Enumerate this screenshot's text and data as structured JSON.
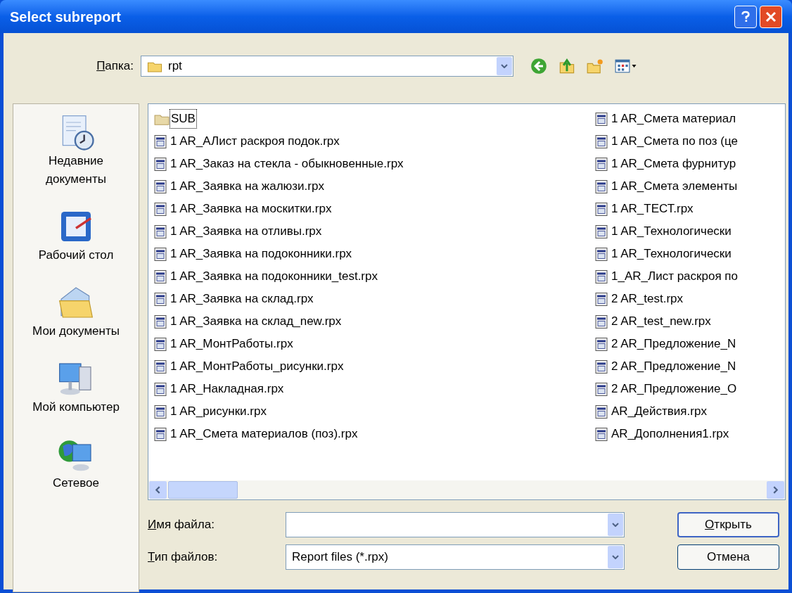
{
  "window": {
    "title": "Select subreport"
  },
  "look_in": {
    "label": {
      "accel": "П",
      "rest": "апка:"
    },
    "value": "rpt"
  },
  "places": [
    {
      "kind": "recent",
      "label": "Недавние документы"
    },
    {
      "kind": "desktop",
      "label": "Рабочий стол"
    },
    {
      "kind": "documents",
      "label": "Мои документы"
    },
    {
      "kind": "computer",
      "label": "Мой компьютер"
    },
    {
      "kind": "network",
      "label": "Сетевое"
    }
  ],
  "files": [
    [
      {
        "kind": "folder",
        "name": "SUB",
        "focused": true
      },
      {
        "kind": "file",
        "name": "1  AR_АЛист раскроя подок.rpx",
        "focused": false
      },
      {
        "kind": "file",
        "name": "1 AR_Заказ на стекла - обыкновенные.rpx",
        "focused": false
      },
      {
        "kind": "file",
        "name": "1 AR_Заявка на жалюзи.rpx",
        "focused": false
      },
      {
        "kind": "file",
        "name": "1 AR_Заявка на москитки.rpx",
        "focused": false
      },
      {
        "kind": "file",
        "name": "1 AR_Заявка на отливы.rpx",
        "focused": false
      },
      {
        "kind": "file",
        "name": "1 AR_Заявка на подоконники.rpx",
        "focused": false
      },
      {
        "kind": "file",
        "name": "1 AR_Заявка на подоконники_test.rpx",
        "focused": false
      },
      {
        "kind": "file",
        "name": "1 AR_Заявка на склад.rpx",
        "focused": false
      },
      {
        "kind": "file",
        "name": "1 AR_Заявка на склад_new.rpx",
        "focused": false
      },
      {
        "kind": "file",
        "name": "1 AR_МонтРаботы.rpx",
        "focused": false
      },
      {
        "kind": "file",
        "name": "1 AR_МонтРаботы_рисунки.rpx",
        "focused": false
      },
      {
        "kind": "file",
        "name": "1 AR_Накладная.rpx",
        "focused": false
      },
      {
        "kind": "file",
        "name": "1 AR_рисунки.rpx",
        "focused": false
      },
      {
        "kind": "file",
        "name": "1 AR_Смета материалов (поз).rpx",
        "focused": false
      }
    ],
    [
      {
        "kind": "file",
        "name": "1 AR_Смета материал",
        "focused": false
      },
      {
        "kind": "file",
        "name": "1 AR_Смета по поз (це",
        "focused": false
      },
      {
        "kind": "file",
        "name": "1 AR_Смета фурнитур",
        "focused": false
      },
      {
        "kind": "file",
        "name": "1 AR_Смета элементы",
        "focused": false
      },
      {
        "kind": "file",
        "name": "1 AR_ТЕСТ.rpx",
        "focused": false
      },
      {
        "kind": "file",
        "name": "1 AR_Технологически",
        "focused": false
      },
      {
        "kind": "file",
        "name": "1 AR_Технологически",
        "focused": false
      },
      {
        "kind": "file",
        "name": "1_AR_Лист раскроя по",
        "focused": false
      },
      {
        "kind": "file",
        "name": "2 AR_test.rpx",
        "focused": false
      },
      {
        "kind": "file",
        "name": "2 AR_test_new.rpx",
        "focused": false
      },
      {
        "kind": "file",
        "name": "2 AR_Предложение_N",
        "focused": false
      },
      {
        "kind": "file",
        "name": "2 AR_Предложение_N",
        "focused": false
      },
      {
        "kind": "file",
        "name": "2 AR_Предложение_О",
        "focused": false
      },
      {
        "kind": "file",
        "name": "AR_Действия.rpx",
        "focused": false
      },
      {
        "kind": "file",
        "name": "AR_Дополнения1.rpx",
        "focused": false
      }
    ]
  ],
  "file_name": {
    "label": {
      "accel": "И",
      "rest": "мя файла:"
    }
  },
  "file_type": {
    "label": {
      "accel": "Т",
      "rest": "ип файлов:"
    },
    "value": "Report files (*.rpx)"
  },
  "buttons": [
    {
      "kind": "default",
      "label": {
        "accel": "О",
        "rest": "ткрыть"
      }
    },
    {
      "kind": "normal",
      "label": {
        "rest": "Отмена"
      }
    }
  ]
}
